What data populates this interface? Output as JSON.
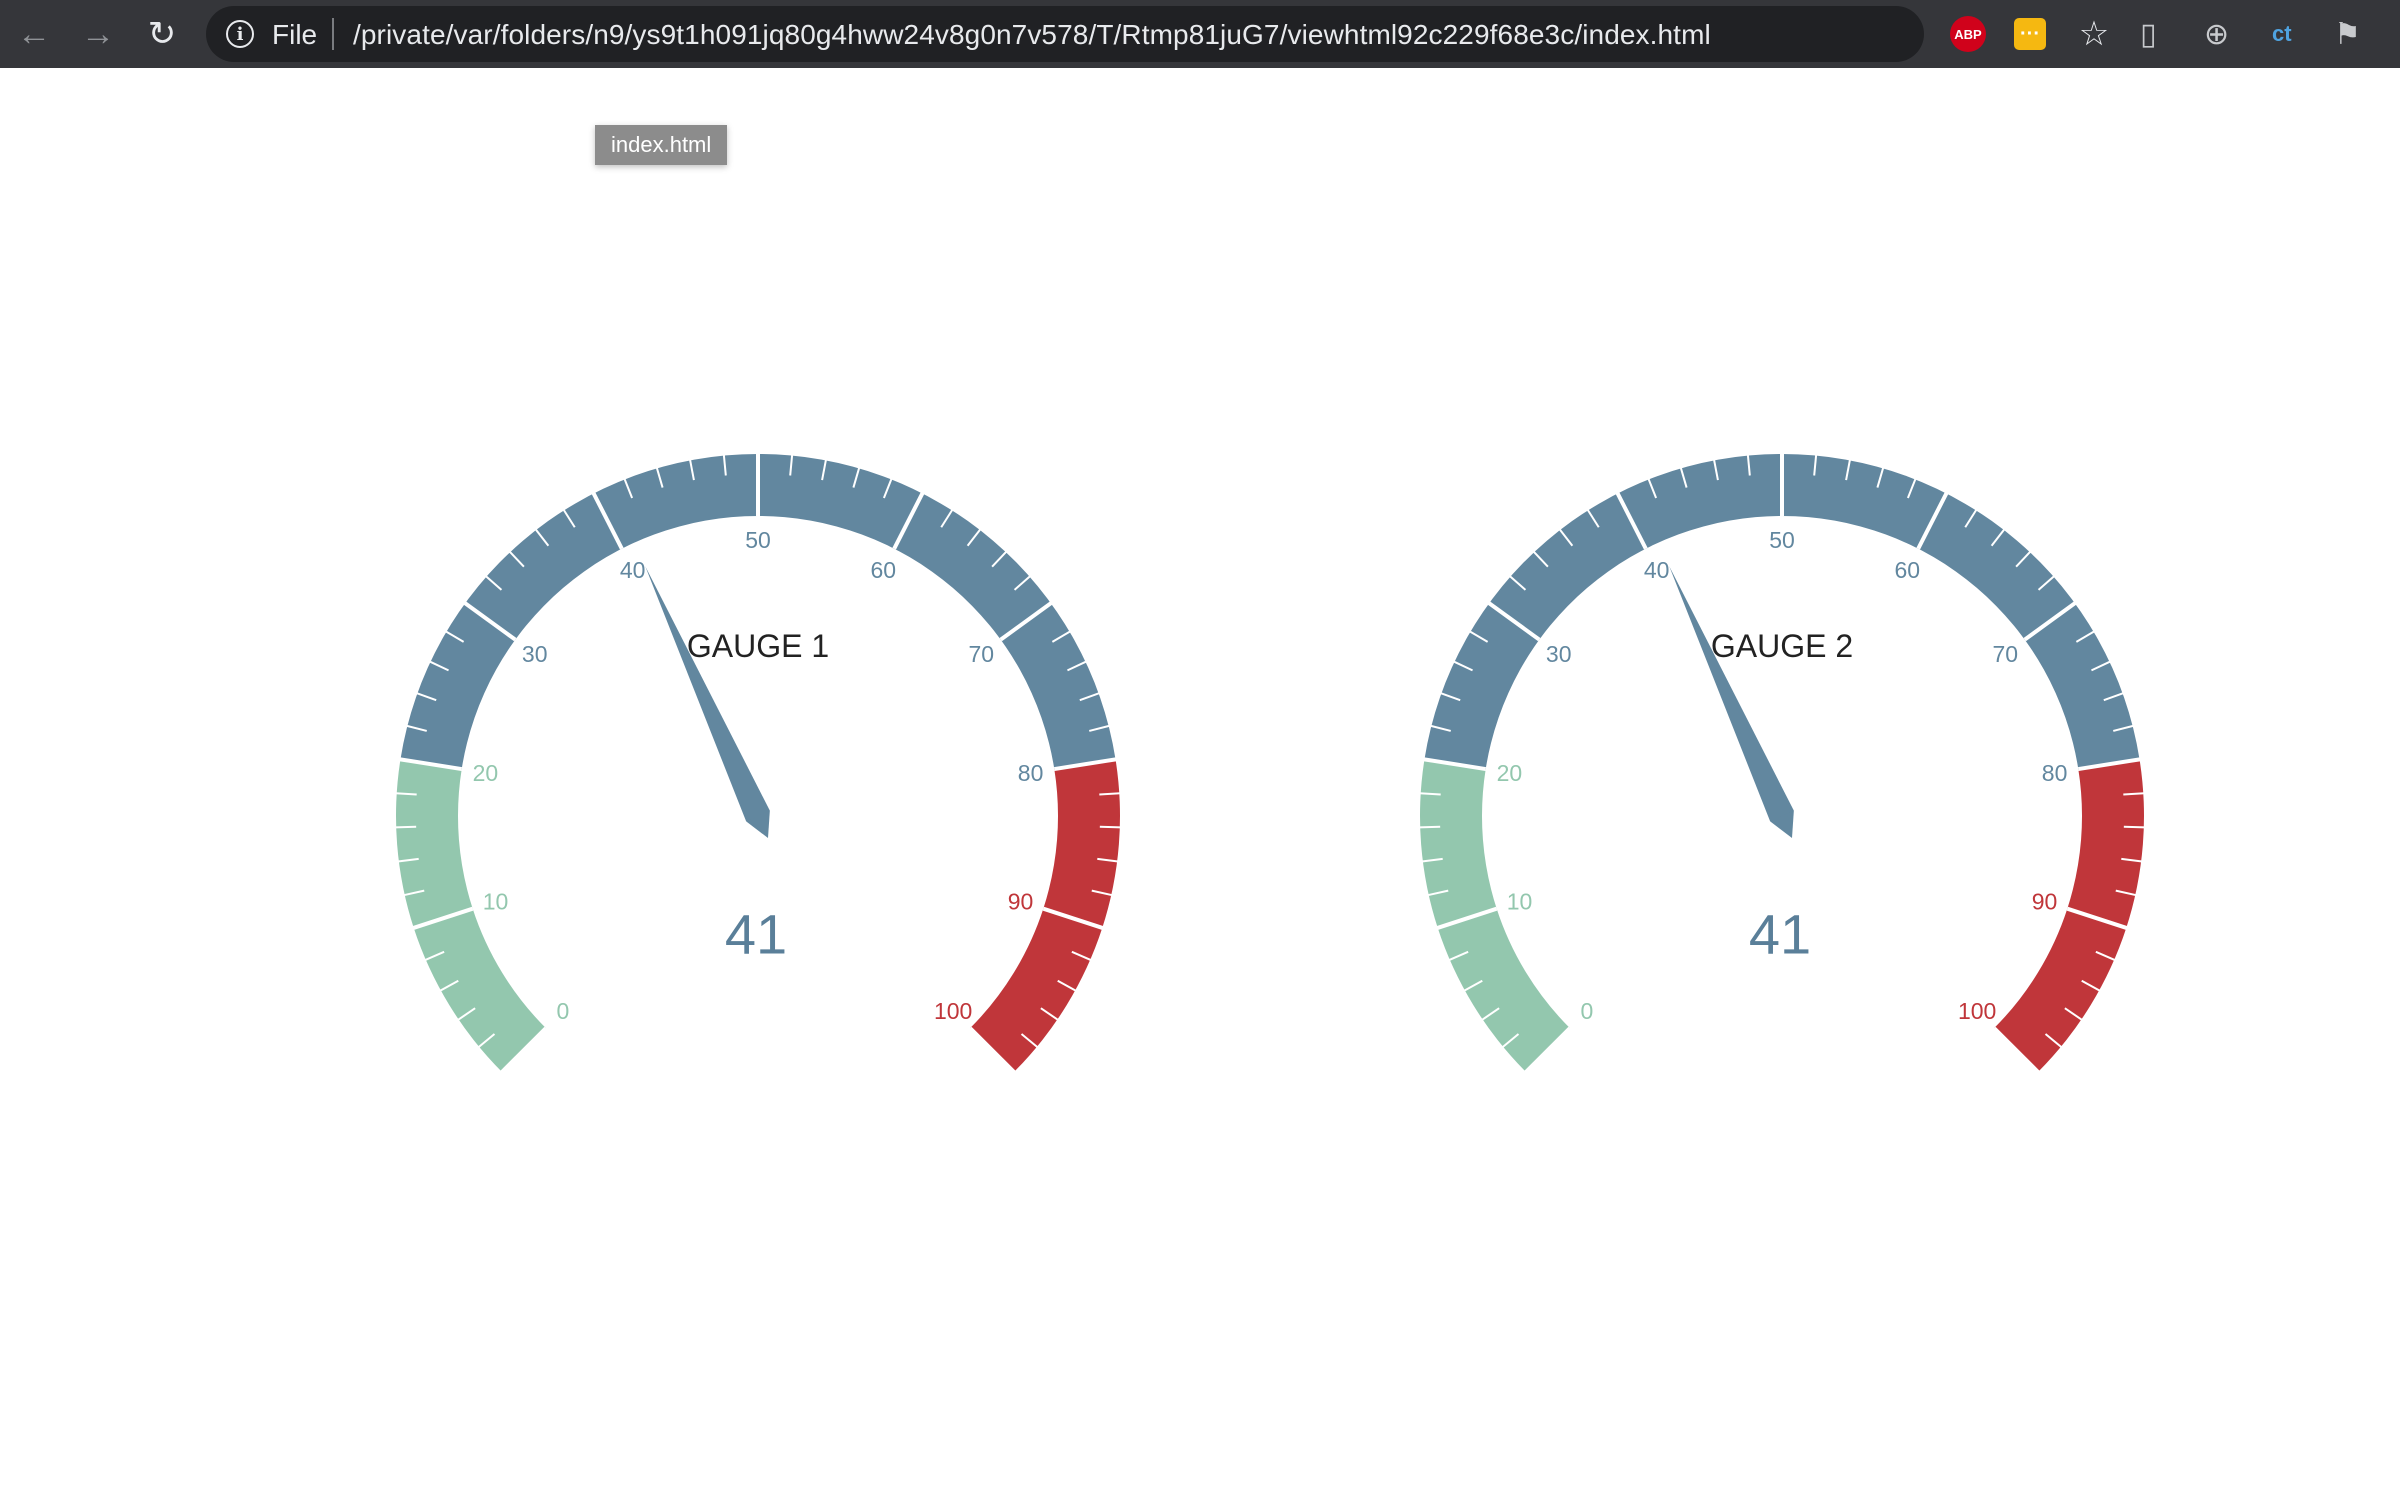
{
  "browser": {
    "scheme_label": "File",
    "url": "/private/var/folders/n9/ys9t1h091jq80g4hww24v8g0n7v578/T/Rtmp81juG7/viewhtml92c229f68e3c/index.html",
    "tooltip": "index.html",
    "extensions": {
      "abp_label": "ABP",
      "ct_label": "ct"
    }
  },
  "colors": {
    "green": "#93c7ae",
    "blue": "#62879f",
    "red": "#c0363a"
  },
  "gauges": [
    {
      "title": "GAUGE 1",
      "value": 41,
      "display_value": "41",
      "min": 0,
      "max": 100,
      "major_tick_labels": [
        "0",
        "10",
        "20",
        "30",
        "40",
        "50",
        "60",
        "70",
        "80",
        "90",
        "100"
      ],
      "bands": [
        {
          "from": 0,
          "to": 20,
          "color": "#93c7ae"
        },
        {
          "from": 20,
          "to": 80,
          "color": "#62879f"
        },
        {
          "from": 80,
          "to": 100,
          "color": "#c0363a"
        }
      ]
    },
    {
      "title": "GAUGE 2",
      "value": 41,
      "display_value": "41",
      "min": 0,
      "max": 100,
      "major_tick_labels": [
        "0",
        "10",
        "20",
        "30",
        "40",
        "50",
        "60",
        "70",
        "80",
        "90",
        "100"
      ],
      "bands": [
        {
          "from": 0,
          "to": 20,
          "color": "#93c7ae"
        },
        {
          "from": 20,
          "to": 80,
          "color": "#62879f"
        },
        {
          "from": 80,
          "to": 100,
          "color": "#c0363a"
        }
      ]
    }
  ]
}
